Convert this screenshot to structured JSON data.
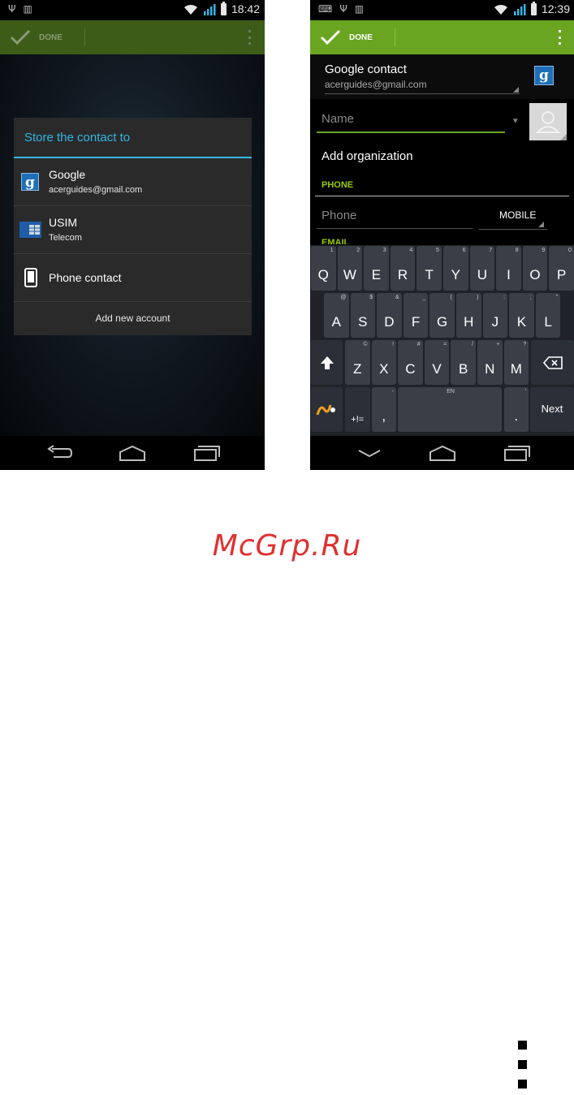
{
  "left_phone": {
    "status": {
      "time": "18:42"
    },
    "actionbar": {
      "done_label": "DONE"
    },
    "dialog": {
      "title": "Store the contact to",
      "accounts": [
        {
          "title": "Google",
          "subtitle": "acerguides@gmail.com",
          "icon": "google-icon"
        },
        {
          "title": "USIM",
          "subtitle": "Telecom",
          "icon": "sim-card-icon"
        },
        {
          "title": "Phone contact",
          "icon": "phone-icon"
        }
      ],
      "add_account": "Add new account"
    }
  },
  "right_phone": {
    "status": {
      "time": "12:39"
    },
    "actionbar": {
      "done_label": "DONE"
    },
    "account": {
      "title": "Google contact",
      "email": "acerguides@gmail.com"
    },
    "form": {
      "name_placeholder": "Name",
      "add_organization": "Add organization",
      "phone_section": "PHONE",
      "phone_placeholder": "Phone",
      "phone_type": "MOBILE",
      "email_section": "EMAIL"
    },
    "keyboard": {
      "row1": [
        {
          "k": "Q",
          "h": "1"
        },
        {
          "k": "W",
          "h": "2"
        },
        {
          "k": "E",
          "h": "3"
        },
        {
          "k": "R",
          "h": "4"
        },
        {
          "k": "T",
          "h": "5"
        },
        {
          "k": "Y",
          "h": "6"
        },
        {
          "k": "U",
          "h": "7"
        },
        {
          "k": "I",
          "h": "8"
        },
        {
          "k": "O",
          "h": "9"
        },
        {
          "k": "P",
          "h": "0"
        }
      ],
      "row2": [
        {
          "k": "A",
          "h": "@"
        },
        {
          "k": "S",
          "h": "$"
        },
        {
          "k": "D",
          "h": "&"
        },
        {
          "k": "F",
          "h": "_"
        },
        {
          "k": "G",
          "h": "("
        },
        {
          "k": "H",
          "h": ")"
        },
        {
          "k": "J",
          "h": ":"
        },
        {
          "k": "K",
          "h": ";"
        },
        {
          "k": "L",
          "h": "\""
        }
      ],
      "row3": [
        {
          "k": "Z",
          "h": "©"
        },
        {
          "k": "X",
          "h": "!"
        },
        {
          "k": "C",
          "h": "#"
        },
        {
          "k": "V",
          "h": "="
        },
        {
          "k": "B",
          "h": "/"
        },
        {
          "k": "N",
          "h": "+"
        },
        {
          "k": "M",
          "h": "?"
        }
      ],
      "symbols_label": "+!=",
      "comma": ",",
      "comma_hint": "-",
      "space_hint": "EN",
      "period": ".",
      "period_hint": "'",
      "next_label": "Next"
    }
  },
  "watermark": "McGrp.Ru",
  "colors": {
    "accent_blue": "#33b5e5",
    "accent_green": "#99cc00",
    "actionbar_green": "#6aa521",
    "watermark_red": "#e03030"
  }
}
